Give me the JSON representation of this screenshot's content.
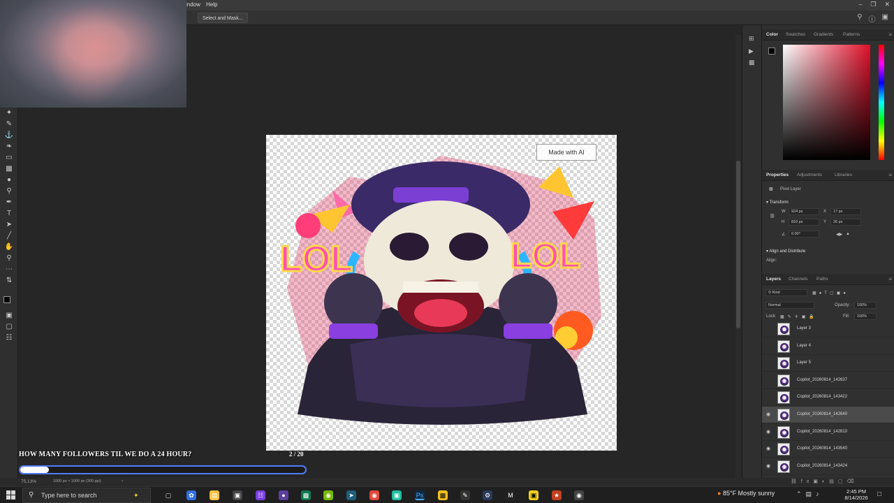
{
  "menubar": {
    "items": [
      "indow",
      "Help"
    ]
  },
  "options_bar": {
    "select_and_mask": "Select and Mask..."
  },
  "canvas": {
    "badge_text": "Made with AI",
    "artwork_text_left": "LOL",
    "artwork_text_right": "LOL"
  },
  "color_panel": {
    "tabs": [
      "Color",
      "Swatches",
      "Gradients",
      "Patterns"
    ],
    "active_tab": "Color",
    "foreground": "#000000",
    "background": "#ffffff"
  },
  "properties_panel": {
    "tabs": [
      "Properties",
      "Adjustments",
      "Libraries"
    ],
    "layer_type": "Pixel Layer",
    "section_transform": "Transform",
    "w": "924 px",
    "h": "810 px",
    "x": "17 px",
    "y": "26 px",
    "angle": "0.00°",
    "section_align": "Align and Distribute",
    "align_label": "Align:"
  },
  "layers_panel": {
    "tabs": [
      "Layers",
      "Channels",
      "Paths"
    ],
    "filter_kind": "Kind",
    "blend_mode": "Normal",
    "opacity_label": "Opacity:",
    "opacity": "100%",
    "lock_label": "Lock:",
    "fill_label": "Fill:",
    "fill": "100%",
    "layers": [
      {
        "name": "Layer 3",
        "visible": false,
        "selected": false
      },
      {
        "name": "Layer 4",
        "visible": false,
        "selected": false
      },
      {
        "name": "Layer 5",
        "visible": false,
        "selected": false
      },
      {
        "name": "Copilot_20260814_142637",
        "visible": false,
        "selected": false
      },
      {
        "name": "Copilot_20260814_143422",
        "visible": false,
        "selected": false
      },
      {
        "name": "Copilot_20260814_142640",
        "visible": true,
        "selected": true
      },
      {
        "name": "Copilot_20260814_142810",
        "visible": true,
        "selected": false
      },
      {
        "name": "Copilot_20260814_143540",
        "visible": true,
        "selected": false
      },
      {
        "name": "Copilot_20260814_143424",
        "visible": true,
        "selected": false
      }
    ]
  },
  "status_bar": {
    "zoom": "75.13%",
    "doc_info": "1000 px × 1000 px (300 ppi)"
  },
  "stream_overlay": {
    "question": "HOW MANY FOLLOWERS TIL WE DO A 24 HOUR?",
    "count": "2 / 20",
    "progress": 0.1
  },
  "taskbar": {
    "search_placeholder": "Type here to search",
    "weather": "85°F  Mostly sunny",
    "time": "2:45 PM",
    "date": "8/14/2026",
    "accent": "#4f7cff"
  }
}
